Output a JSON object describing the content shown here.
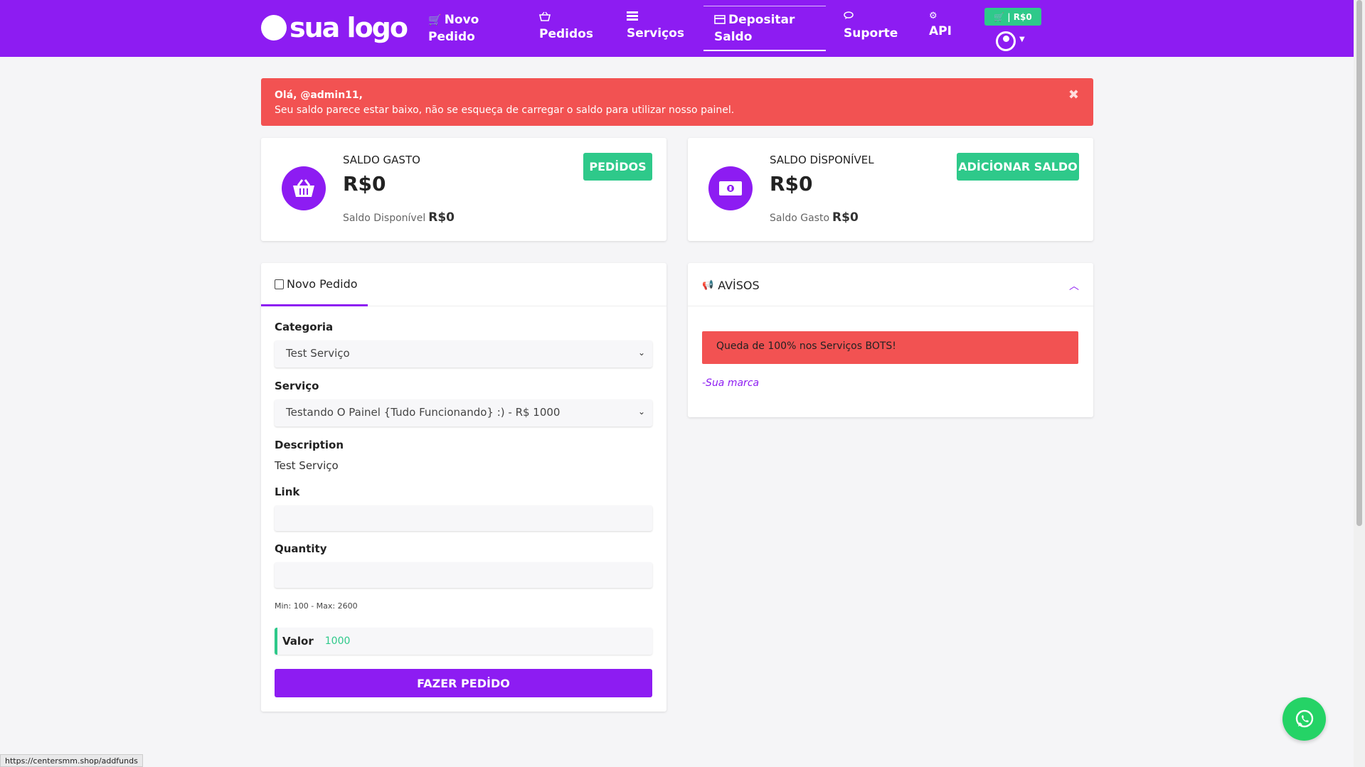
{
  "nav": {
    "logo_text": "sua logo",
    "items": [
      {
        "line1": "Novo",
        "line2": "Pedido",
        "icon": "cart-icon"
      },
      {
        "label": "Pedidos",
        "icon": "basket-icon"
      },
      {
        "label": "Serviços",
        "icon": "list-icon"
      },
      {
        "line1": "Depositar",
        "line2": "Saldo",
        "icon": "card-icon"
      },
      {
        "label": "Suporte",
        "icon": "chat-icon"
      },
      {
        "label": "API",
        "icon": "gear-icon"
      }
    ],
    "cart_badge": "| R$0"
  },
  "alert": {
    "greeting": "Olá, @admin11,",
    "message": "Seu saldo parece estar baixo, não se esqueça de carregar o saldo para utilizar nosso painel."
  },
  "stats": {
    "spent": {
      "label": "SALDO GASTO",
      "value": "R$0",
      "sub_label": "Saldo Disponível",
      "sub_value": "R$0",
      "button": "PEDİDOS"
    },
    "available": {
      "label": "SALDO DİSPONÍVEL",
      "value": "R$0",
      "sub_label": "Saldo Gasto",
      "sub_value": "R$0",
      "button": "ADİCİONAR SALDO"
    }
  },
  "order": {
    "tab": "Novo Pedido",
    "category_label": "Categoria",
    "category_value": "Test Serviço",
    "service_label": "Serviço",
    "service_value": "Testando O Painel {Tudo Funcionando} :) - R$ 1000",
    "description_label": "Description",
    "description_value": "Test Serviço",
    "link_label": "Link",
    "quantity_label": "Quantity",
    "quantity_hint": "Min: 100 - Max: 2600",
    "valor_label": "Valor",
    "valor_value": "1000",
    "submit": "FAZER PEDİDO"
  },
  "announcements": {
    "title": "AVİSOS",
    "notice": "Queda de 100% nos Serviços BOTS!",
    "signature": "-Sua marca"
  },
  "status_url": "https://centersmm.shop/addfunds",
  "colors": {
    "brand": "#8d1cf2",
    "success": "#2ec98a",
    "danger": "#f25252"
  }
}
